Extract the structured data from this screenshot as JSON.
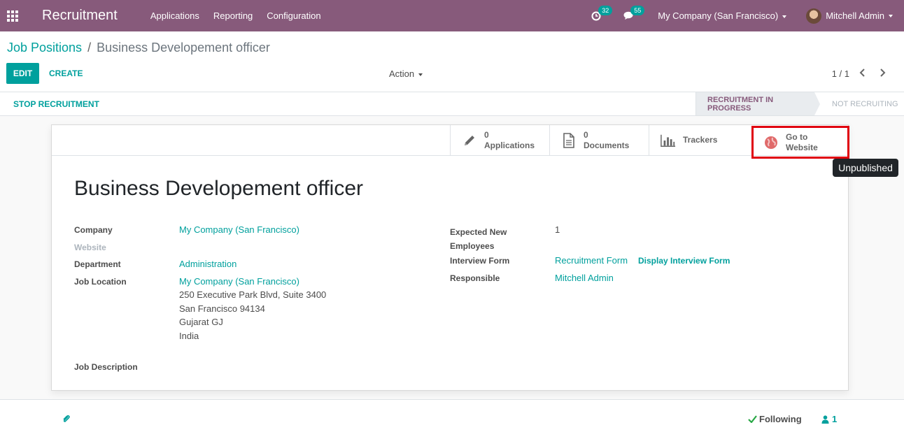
{
  "navbar": {
    "app_title": "Recruitment",
    "menu": [
      "Applications",
      "Reporting",
      "Configuration"
    ],
    "activity_count": "32",
    "message_count": "55",
    "company": "My Company (San Francisco)",
    "user": "Mitchell Admin"
  },
  "control_panel": {
    "breadcrumb_parent": "Job Positions",
    "breadcrumb_separator": "/",
    "breadcrumb_current": "Business Developement officer",
    "edit_label": "EDIT",
    "create_label": "CREATE",
    "action_label": "Action",
    "pager": "1 / 1"
  },
  "statusbar": {
    "stop_label": "STOP RECRUITMENT",
    "stage_active": "RECRUITMENT IN PROGRESS",
    "stage_inactive": "NOT RECRUITING"
  },
  "smart_buttons": {
    "applications_value": "0",
    "applications_label": "Applications",
    "documents_value": "0",
    "documents_label": "Documents",
    "trackers_label": "Trackers",
    "website_line1": "Go to",
    "website_line2": "Website",
    "website_tooltip": "Unpublished"
  },
  "record": {
    "title": "Business Developement officer",
    "company_label": "Company",
    "company_value": "My Company (San Francisco)",
    "website_label": "Website",
    "department_label": "Department",
    "department_value": "Administration",
    "job_location_label": "Job Location",
    "job_location_name": "My Company (San Francisco)",
    "job_location_address": [
      "250 Executive Park Blvd, Suite 3400",
      "San Francisco 94134",
      "Gujarat GJ",
      "India"
    ],
    "expected_label_1": "Expected New",
    "expected_label_2": "Employees",
    "expected_value": "1",
    "interview_form_label": "Interview Form",
    "interview_form_value": "Recruitment Form",
    "display_interview_form": "Display Interview Form",
    "responsible_label": "Responsible",
    "responsible_value": "Mitchell Admin",
    "job_description_label": "Job Description"
  },
  "chatter": {
    "following_label": "Following",
    "followers_count": "1"
  },
  "colors": {
    "brand": "#875a7b",
    "accent": "#00a09d",
    "highlight": "#e0000f"
  }
}
